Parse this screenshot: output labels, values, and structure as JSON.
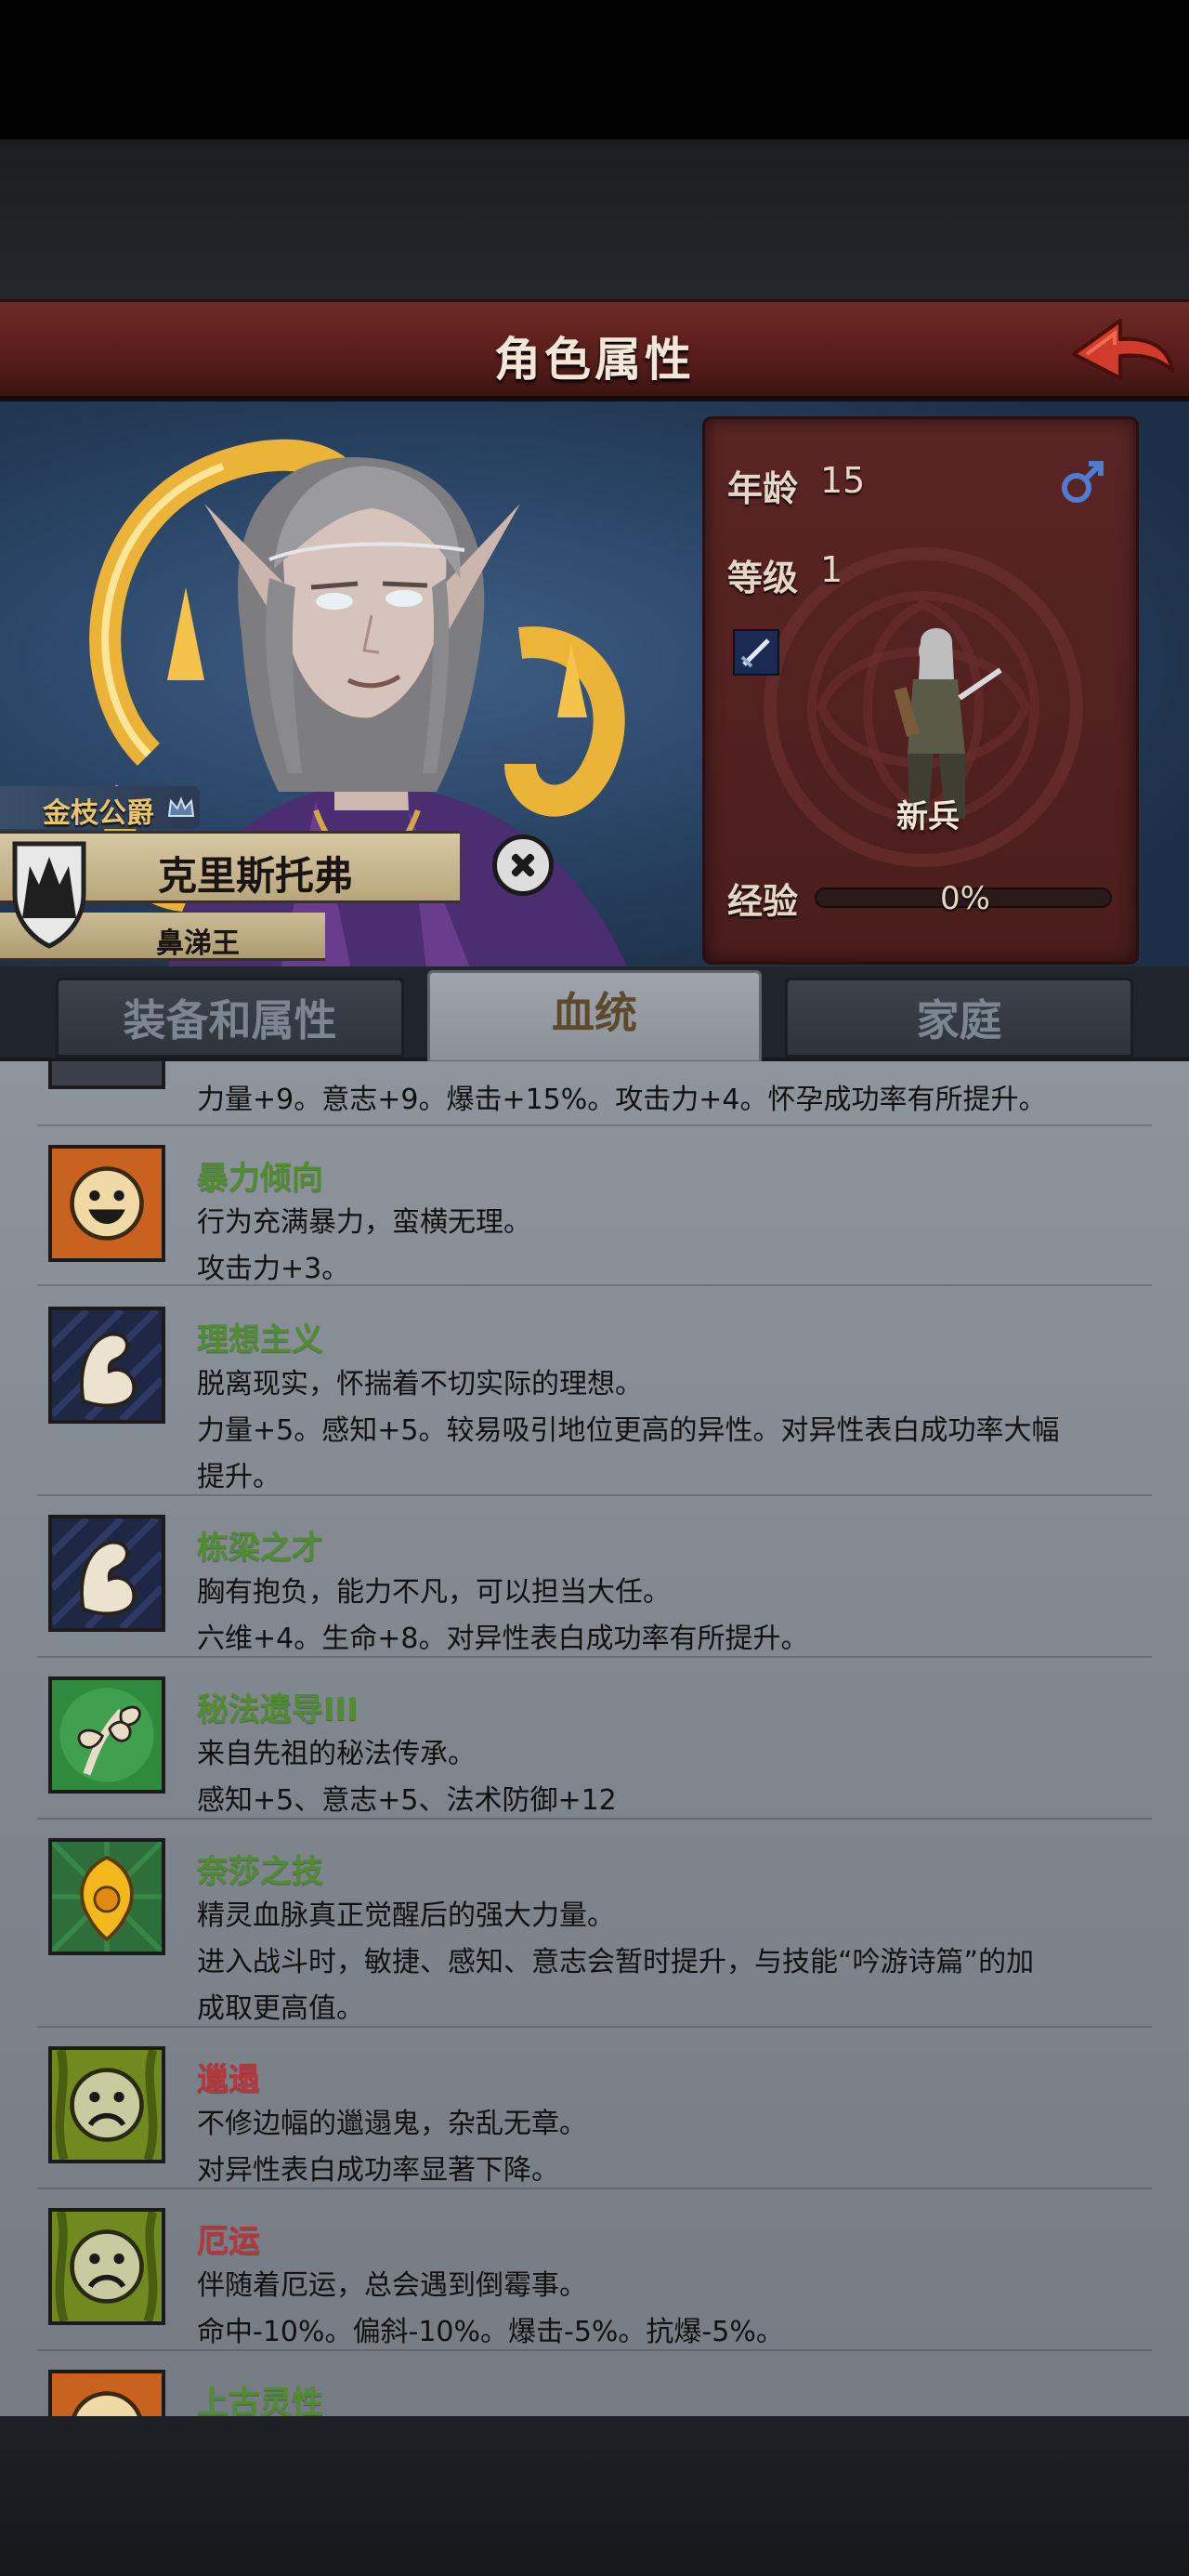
{
  "header": {
    "title": "角色属性"
  },
  "character": {
    "rank_title": "金枝公爵",
    "name": "克里斯托弗",
    "epithet": "鼻涕王",
    "gender_icon": "male-symbol-icon"
  },
  "stats": {
    "age_label": "年龄",
    "age_value": "15",
    "level_label": "等级",
    "level_value": "1",
    "class_name": "新兵",
    "exp_label": "经验",
    "exp_percent": "0%",
    "exp_fraction": 0.0
  },
  "tabs": [
    {
      "label": "装备和属性",
      "active": false
    },
    {
      "label": "血统",
      "active": true
    },
    {
      "label": "家庭",
      "active": false
    }
  ],
  "traits": [
    {
      "name": "",
      "kind": "good",
      "icon": "partial-trait-icon",
      "lines": [
        "力量+9。意志+9。爆击+15%。攻击力+4。怀孕成功率有所提升。"
      ]
    },
    {
      "name": "暴力倾向",
      "kind": "good",
      "icon": "happy-face-icon",
      "lines": [
        "行为充满暴力，蛮横无理。",
        "攻击力+3。"
      ]
    },
    {
      "name": "理想主义",
      "kind": "good",
      "icon": "flexed-arm-icon",
      "lines": [
        "脱离现实，怀揣着不切实际的理想。",
        "力量+5。感知+5。较易吸引地位更高的异性。对异性表白成功率大幅",
        "提升。"
      ]
    },
    {
      "name": "栋梁之才",
      "kind": "good",
      "icon": "flexed-arm-icon",
      "lines": [
        "胸有抱负，能力不凡，可以担当大任。",
        "六维+4。生命+8。对异性表白成功率有所提升。"
      ]
    },
    {
      "name": "秘法遗导III",
      "kind": "good",
      "icon": "sprout-icon",
      "lines": [
        "来自先祖的秘法传承。",
        "感知+5、意志+5、法术防御+12"
      ]
    },
    {
      "name": "奈莎之技",
      "kind": "good",
      "icon": "golden-flame-icon",
      "lines": [
        "精灵血脉真正觉醒后的强大力量。",
        "进入战斗时，敏捷、感知、意志会暂时提升，与技能“吟游诗篇”的加",
        "成取更高值。"
      ]
    },
    {
      "name": "邋遢",
      "kind": "bad",
      "icon": "sad-face-icon",
      "lines": [
        "不修边幅的邋遢鬼，杂乱无章。",
        "对异性表白成功率显著下降。"
      ]
    },
    {
      "name": "厄运",
      "kind": "bad",
      "icon": "sad-face-icon",
      "lines": [
        "伴随着厄运，总会遇到倒霉事。",
        "命中-10%。偏斜-10%。爆击-5%。抗爆-5%。"
      ]
    },
    {
      "name": "上古灵性",
      "kind": "good",
      "icon": "happy-face-icon",
      "lines": []
    }
  ]
}
